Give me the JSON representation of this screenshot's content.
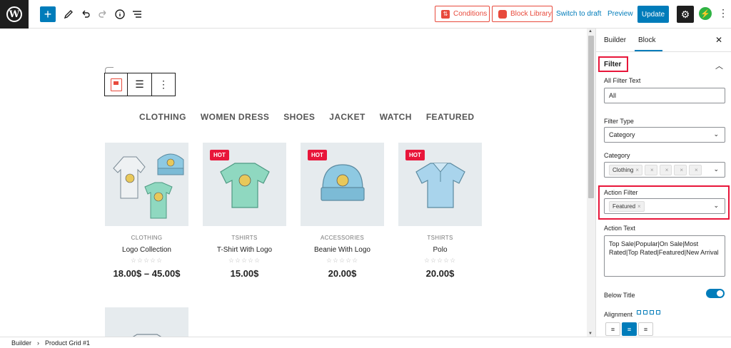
{
  "toolbar": {
    "add_label": "+",
    "conditions_label": "Conditions",
    "block_library_label": "Block Library",
    "switch_draft_label": "Switch to draft",
    "preview_label": "Preview",
    "update_label": "Update"
  },
  "filter_nav": [
    "CLOTHING",
    "WOMEN DRESS",
    "SHOES",
    "JACKET",
    "WATCH",
    "FEATURED"
  ],
  "products": [
    {
      "category": "CLOTHING",
      "name": "Logo Collection",
      "price": "18.00$ – 45.00$",
      "hot": "",
      "stars": "☆☆☆☆☆"
    },
    {
      "category": "TSHIRTS",
      "name": "T-Shirt With Logo",
      "price": "15.00$",
      "hot": "HOT",
      "stars": "☆☆☆☆☆"
    },
    {
      "category": "ACCESSORIES",
      "name": "Beanie With Logo",
      "price": "20.00$",
      "hot": "HOT",
      "stars": "☆☆☆☆☆"
    },
    {
      "category": "TSHIRTS",
      "name": "Polo",
      "price": "20.00$",
      "hot": "HOT",
      "stars": "☆☆☆☆☆"
    }
  ],
  "sidebar": {
    "tab_builder": "Builder",
    "tab_block": "Block",
    "close": "✕",
    "panel_title": "Filter",
    "all_filter_text_label": "All Filter Text",
    "all_filter_text_value": "All",
    "filter_type_label": "Filter Type",
    "filter_type_value": "Category",
    "category_label": "Category",
    "category_chip": "Clothing",
    "action_filter_label": "Action Filter",
    "action_filter_chip": "Featured",
    "action_text_label": "Action Text",
    "action_text_value": "Top Sale|Popular|On Sale|Most Rated|Top Rated|Featured|New Arrival",
    "below_title_label": "Below Title",
    "alignment_label": "Alignment"
  },
  "footer": {
    "crumb_root": "Builder",
    "crumb_current": "Product Grid #1"
  },
  "colors": {
    "accent": "#007cba",
    "brand_red": "#e84a3c",
    "hot_badge": "#e8163a"
  }
}
